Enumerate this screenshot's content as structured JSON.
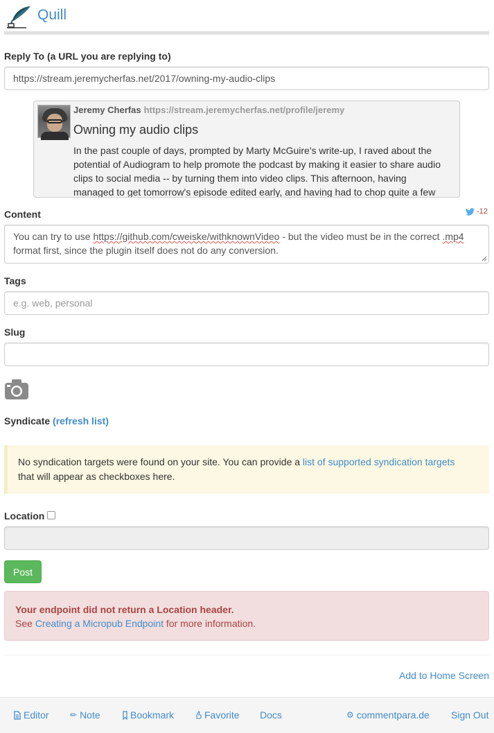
{
  "app": {
    "brand": "Quill",
    "brand_color": "#428bca"
  },
  "reply": {
    "label": "Reply To (a URL you are replying to)",
    "value": "https://stream.jeremycherfas.net/2017/owning-my-audio-clips"
  },
  "context": {
    "author_name": "Jeremy Cherfas",
    "author_url": "https://stream.jeremycherfas.net/profile/jeremy",
    "title": "Owning my audio clips",
    "body": "In the past couple of days, prompted by Marty McGuire's write-up, I raved about the potential of Audiogram to help promote the podcast by making it easier to share audio clips to social media -- by turning them into video clips. This afternoon, having managed to get tomorrow's episode edited early, and having had to chop quite a few interesting"
  },
  "content": {
    "label": "Content",
    "char_count": "-12",
    "text_before_link": "You can try to use ",
    "link_text": "https://github.com/cweiske/withknownVideo",
    "text_middle": " - but the video must be in the correct ",
    "format_word": ".mp4",
    "text_after": " format first, since the plugin itself does not do any conversion."
  },
  "tags": {
    "label": "Tags",
    "placeholder": "e.g. web, personal"
  },
  "slug": {
    "label": "Slug",
    "value": ""
  },
  "syndicate": {
    "label": "Syndicate",
    "refresh_label": "(refresh list)",
    "notice_before": "No syndication targets were found on your site. You can provide a ",
    "notice_link": "list of supported syndication targets",
    "notice_after": " that will appear as checkboxes here."
  },
  "location": {
    "label": "Location",
    "checked": false
  },
  "post_button": "Post",
  "error": {
    "heading": "Your endpoint did not return a Location header.",
    "see": "See ",
    "link": "Creating a Micropub Endpoint",
    "after": " for more information."
  },
  "home_link": "Add to Home Screen",
  "footer": {
    "editor": "Editor",
    "note": "Note",
    "bookmark": "Bookmark",
    "favorite": "Favorite",
    "docs": "Docs",
    "site": "commentpara.de",
    "signout": "Sign Out"
  }
}
